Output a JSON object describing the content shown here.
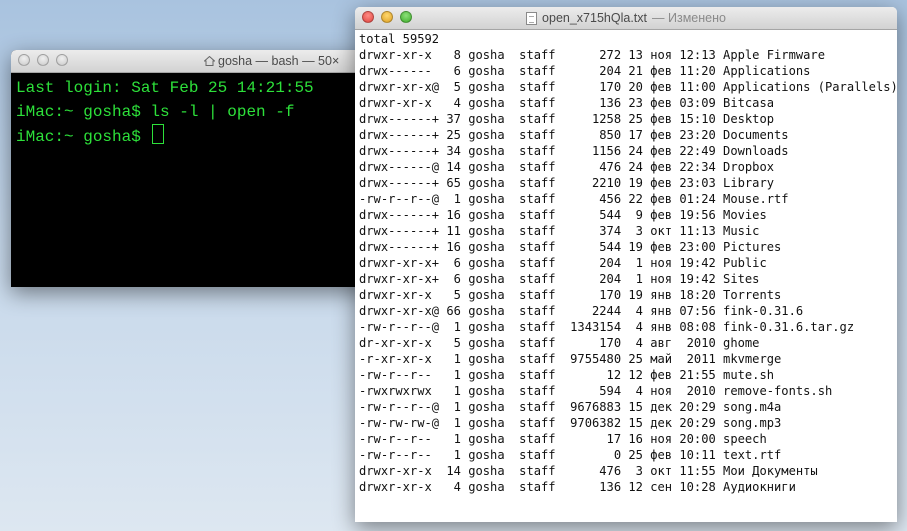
{
  "terminal": {
    "title": "gosha — bash — 50×",
    "lines": [
      "Last login: Sat Feb 25 14:21:55",
      "iMac:~ gosha$ ls -l | open -f",
      "iMac:~ gosha$ "
    ]
  },
  "textedit": {
    "filename": "open_x715hQla.txt",
    "status": "— Изменено",
    "total": "total 59592",
    "rows": [
      "drwxr-xr-x   8 gosha  staff      272 13 ноя 12:13 Apple Firmware",
      "drwx------   6 gosha  staff      204 21 фев 11:20 Applications",
      "drwxr-xr-x@  5 gosha  staff      170 20 фев 11:00 Applications (Parallels)",
      "drwxr-xr-x   4 gosha  staff      136 23 фев 03:09 Bitcasa",
      "drwx------+ 37 gosha  staff     1258 25 фев 15:10 Desktop",
      "drwx------+ 25 gosha  staff      850 17 фев 23:20 Documents",
      "drwx------+ 34 gosha  staff     1156 24 фев 22:49 Downloads",
      "drwx------@ 14 gosha  staff      476 24 фев 22:34 Dropbox",
      "drwx------+ 65 gosha  staff     2210 19 фев 23:03 Library",
      "-rw-r--r--@  1 gosha  staff      456 22 фев 01:24 Mouse.rtf",
      "drwx------+ 16 gosha  staff      544  9 фев 19:56 Movies",
      "drwx------+ 11 gosha  staff      374  3 окт 11:13 Music",
      "drwx------+ 16 gosha  staff      544 19 фев 23:00 Pictures",
      "drwxr-xr-x+  6 gosha  staff      204  1 ноя 19:42 Public",
      "drwxr-xr-x+  6 gosha  staff      204  1 ноя 19:42 Sites",
      "drwxr-xr-x   5 gosha  staff      170 19 янв 18:20 Torrents",
      "drwxr-xr-x@ 66 gosha  staff     2244  4 янв 07:56 fink-0.31.6",
      "-rw-r--r--@  1 gosha  staff  1343154  4 янв 08:08 fink-0.31.6.tar.gz",
      "dr-xr-xr-x   5 gosha  staff      170  4 авг  2010 ghome",
      "-r-xr-xr-x   1 gosha  staff  9755480 25 май  2011 mkvmerge",
      "-rw-r--r--   1 gosha  staff       12 12 фев 21:55 mute.sh",
      "-rwxrwxrwx   1 gosha  staff      594  4 ноя  2010 remove-fonts.sh",
      "-rw-r--r--@  1 gosha  staff  9676883 15 дек 20:29 song.m4a",
      "-rw-rw-rw-@  1 gosha  staff  9706382 15 дек 20:29 song.mp3",
      "-rw-r--r--   1 gosha  staff       17 16 ноя 20:00 speech",
      "-rw-r--r--   1 gosha  staff        0 25 фев 10:11 text.rtf",
      "drwxr-xr-x  14 gosha  staff      476  3 окт 11:55 Мои Документы",
      "drwxr-xr-x   4 gosha  staff      136 12 сен 10:28 Аудиокниги"
    ]
  }
}
